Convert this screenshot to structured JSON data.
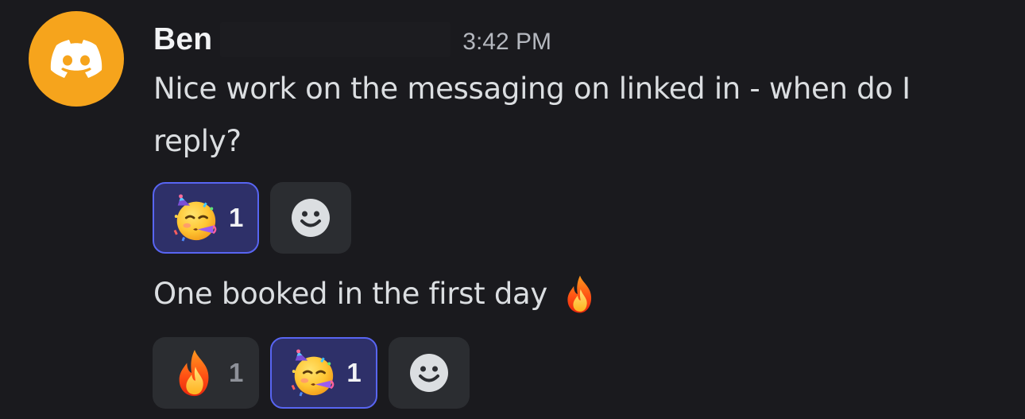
{
  "message": {
    "author": "Ben",
    "timestamp": "3:42 PM",
    "avatar_icon": "discord-logo-icon",
    "avatar_color": "#f6a41c",
    "lines": [
      {
        "text": "Nice work on the messaging on linked in - when do I reply?",
        "reactions": [
          {
            "emoji": "partying-face",
            "count": "1",
            "me": true
          }
        ]
      },
      {
        "text": "One booked in the first day",
        "inline_emoji": "fire",
        "reactions": [
          {
            "emoji": "fire",
            "count": "1",
            "me": false
          },
          {
            "emoji": "partying-face",
            "count": "1",
            "me": true
          }
        ]
      }
    ],
    "add_reaction_icon": "smiley-face-icon"
  },
  "colors": {
    "background": "#1a1a1e",
    "reaction_bg": "#2b2d31",
    "reaction_selected_bg": "#2e3069",
    "reaction_selected_border": "#5865f2"
  }
}
